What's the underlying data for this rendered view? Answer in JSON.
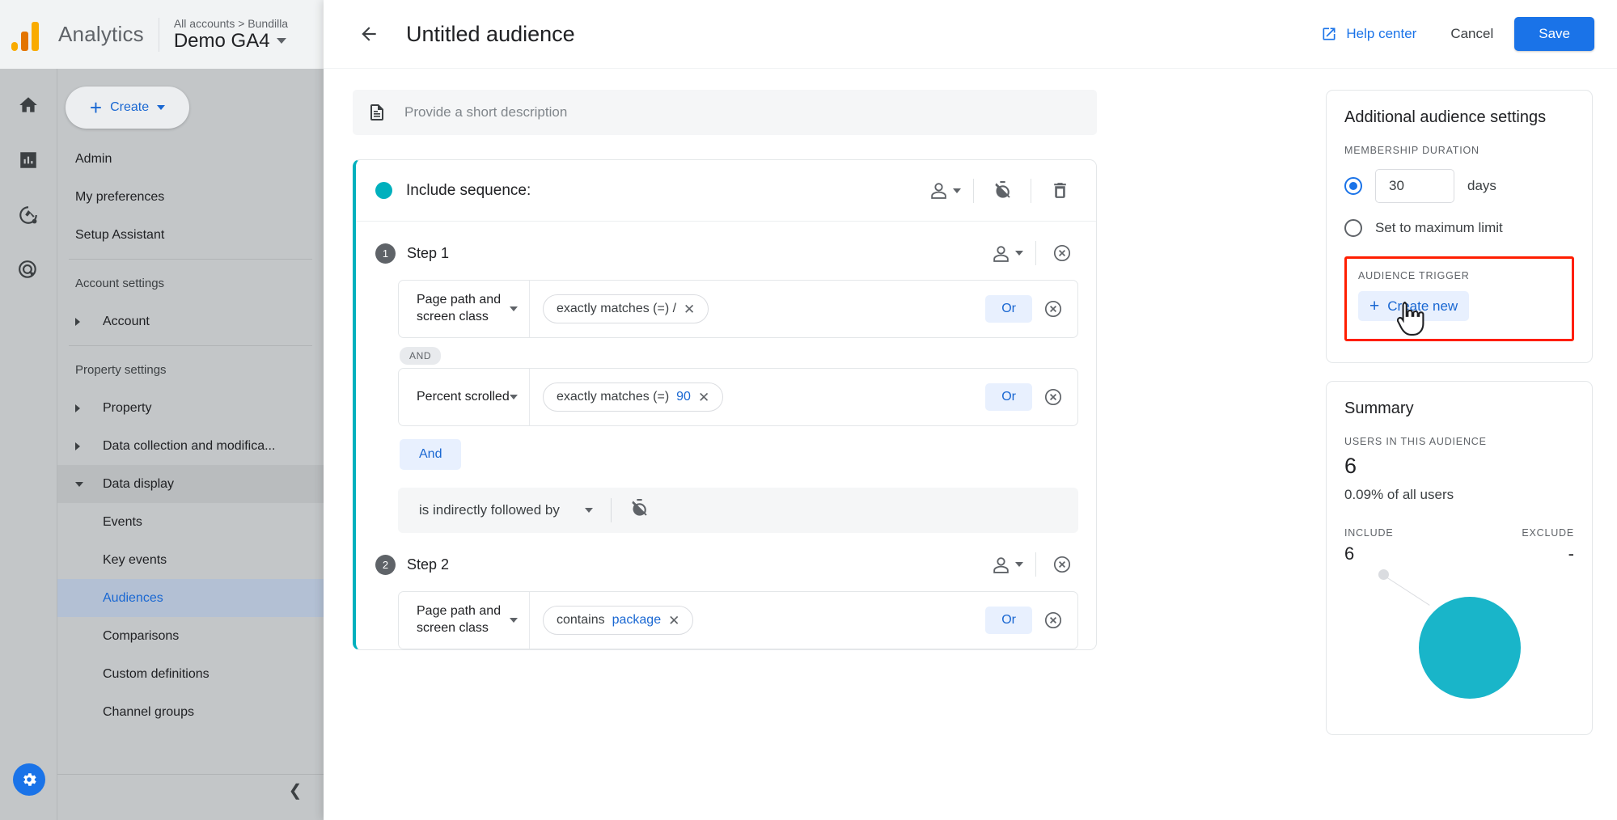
{
  "brand": {
    "name": "Analytics",
    "logo_icon": "analytics-logo-icon"
  },
  "account": {
    "breadcrumb": "All accounts > Bundilla",
    "property": "Demo GA4"
  },
  "rail": [
    {
      "icon": "home-icon",
      "name": "home"
    },
    {
      "icon": "reports-bar-chart-icon",
      "name": "reports"
    },
    {
      "icon": "explore-icon",
      "name": "explore"
    },
    {
      "icon": "advertising-target-icon",
      "name": "advertising"
    }
  ],
  "rail_bottom": {
    "icon": "gear-icon",
    "name": "admin-settings"
  },
  "sidebar": {
    "create_button": "Create",
    "collapse_icon": "chevron-left-icon",
    "items": [
      {
        "label": "Admin",
        "type": "item"
      },
      {
        "label": "My preferences",
        "type": "item"
      },
      {
        "label": "Setup Assistant",
        "type": "item"
      },
      {
        "label": "Account settings",
        "type": "group"
      },
      {
        "label": "Account",
        "type": "expandable",
        "expanded": false
      },
      {
        "label": "Property settings",
        "type": "group"
      },
      {
        "label": "Property",
        "type": "expandable",
        "expanded": false
      },
      {
        "label": "Data collection and modifica...",
        "type": "expandable",
        "expanded": false
      },
      {
        "label": "Data display",
        "type": "expandable",
        "expanded": true
      },
      {
        "label": "Events",
        "type": "sub"
      },
      {
        "label": "Key events",
        "type": "sub"
      },
      {
        "label": "Audiences",
        "type": "sub",
        "active": true
      },
      {
        "label": "Comparisons",
        "type": "sub"
      },
      {
        "label": "Custom definitions",
        "type": "sub"
      },
      {
        "label": "Channel groups",
        "type": "sub"
      }
    ]
  },
  "editor": {
    "back_icon": "back-arrow-icon",
    "title": "Untitled audience",
    "help_label": "Help center",
    "help_icon": "external-link-icon",
    "cancel_label": "Cancel",
    "save_label": "Save",
    "description_placeholder": "Provide a short description",
    "description_icon": "description-icon"
  },
  "sequence": {
    "title": "Include sequence:",
    "scope_icon": "person-icon",
    "timer_icon": "timer-off-icon",
    "delete_icon": "trash-icon",
    "steps": [
      {
        "number": "1",
        "label": "Step 1",
        "scope_icon": "person-icon",
        "remove_icon": "remove-circle-icon",
        "conditions": [
          {
            "dimension": "Page path and screen class",
            "chip_text": "exactly matches (=) /",
            "chip_value": "",
            "or_label": "Or",
            "remove_icon": "remove-circle-icon"
          },
          {
            "joiner": "AND",
            "dimension": "Percent scrolled",
            "chip_text": "exactly matches (=)",
            "chip_value": "90",
            "or_label": "Or",
            "remove_icon": "remove-circle-icon"
          }
        ],
        "and_button": "And"
      },
      {
        "number": "2",
        "label": "Step 2",
        "scope_icon": "person-icon",
        "remove_icon": "remove-circle-icon",
        "conditions": [
          {
            "dimension": "Page path and screen class",
            "chip_text": "contains",
            "chip_value": "package",
            "or_label": "Or",
            "remove_icon": "remove-circle-icon"
          }
        ]
      }
    ],
    "connector": {
      "label": "is indirectly followed by",
      "dropdown_icon": "chevron-down-icon",
      "timer_icon": "timer-off-icon"
    }
  },
  "settings_panel": {
    "title": "Additional audience settings",
    "membership_caption": "MEMBERSHIP DURATION",
    "duration_value": "30",
    "duration_unit": "days",
    "max_limit_label": "Set to maximum limit",
    "duration_selected": true,
    "trigger_caption": "AUDIENCE TRIGGER",
    "create_new_label": "Create new",
    "highlight_color": "#ff1e00"
  },
  "summary_panel": {
    "title": "Summary",
    "users_caption": "USERS IN THIS AUDIENCE",
    "users_count": "6",
    "users_percent": "0.09% of all users",
    "include_caption": "INCLUDE",
    "exclude_caption": "EXCLUDE",
    "include_value": "6",
    "exclude_value": "-",
    "venn_color": "#19b5c9"
  }
}
